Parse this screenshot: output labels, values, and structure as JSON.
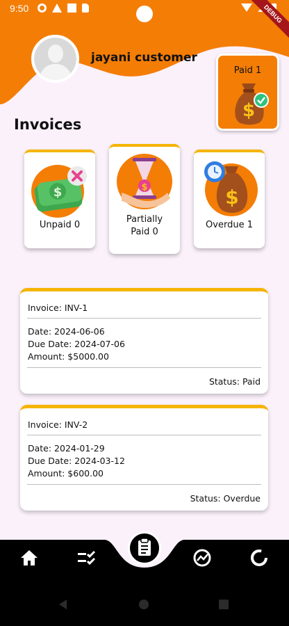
{
  "status_bar": {
    "time": "9:50",
    "icons": [
      "gear-icon",
      "warning-icon",
      "mail-icon",
      "sd-card-icon",
      "wifi-icon",
      "signal-icon",
      "battery-icon"
    ],
    "debug_banner": "DEBUG"
  },
  "header": {
    "user_name": "jayani customer",
    "paid_card": {
      "label": "Paid 1",
      "icon": "money-bag-check-icon"
    }
  },
  "page_title": "Invoices",
  "summary_cards": [
    {
      "label_line1": "Unpaid 0",
      "label_line2": "",
      "icon": "cash-cross-icon"
    },
    {
      "label_line1": "Partially",
      "label_line2": "Paid 0",
      "icon": "hourglass-dollar-icon"
    },
    {
      "label_line1": "Overdue 1",
      "label_line2": "",
      "icon": "money-bag-clock-icon"
    }
  ],
  "invoices": [
    {
      "invoice": "Invoice: INV-1",
      "date": "Date: 2024-06-06",
      "due_date": "Due Date: 2024-07-06",
      "amount": "Amount: $5000.00",
      "status": "Status: Paid"
    },
    {
      "invoice": "Invoice: INV-2",
      "date": "Date: 2024-01-29",
      "due_date": "Due Date: 2024-03-12",
      "amount": "Amount: $600.00",
      "status": "Status: Overdue"
    }
  ],
  "bottom_nav": {
    "items": [
      "home-icon",
      "tasks-checklist-icon",
      "invoices-clipboard-icon",
      "analytics-icon",
      "loading-ring-icon"
    ],
    "active": "invoices-clipboard-icon"
  },
  "system_nav": [
    "back-icon",
    "home-circle-icon",
    "recents-icon"
  ],
  "colors": {
    "primary_orange": "#f47d06",
    "card_accent": "#f5b400",
    "background": "#fbf1fb",
    "nav_bar": "#000000"
  }
}
